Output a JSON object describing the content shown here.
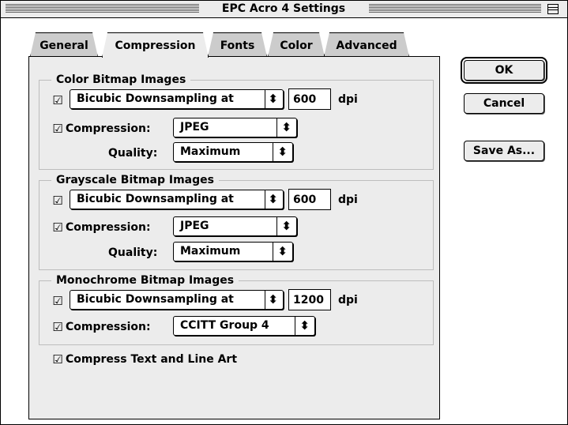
{
  "window": {
    "title": "EPC Acro 4 Settings"
  },
  "tabs": [
    {
      "label": "General",
      "active": false
    },
    {
      "label": "Compression",
      "active": true
    },
    {
      "label": "Fonts",
      "active": false
    },
    {
      "label": "Color",
      "active": false
    },
    {
      "label": "Advanced",
      "active": false
    }
  ],
  "color": {
    "title": "Color Bitmap Images",
    "downsample_checked": true,
    "downsample": "Bicubic Downsampling at",
    "dpi_value": "600",
    "compression_checked": true,
    "compression_label": "Compression:",
    "compression": "JPEG",
    "quality_label": "Quality:",
    "quality": "Maximum"
  },
  "grayscale": {
    "title": "Grayscale Bitmap Images",
    "downsample_checked": true,
    "downsample": "Bicubic Downsampling at",
    "dpi_value": "600",
    "compression_checked": true,
    "compression_label": "Compression:",
    "compression": "JPEG",
    "quality_label": "Quality:",
    "quality": "Maximum"
  },
  "mono": {
    "title": "Monochrome Bitmap Images",
    "downsample_checked": true,
    "downsample": "Bicubic Downsampling at",
    "dpi_value": "1200",
    "compression_checked": true,
    "compression_label": "Compression:",
    "compression": "CCITT Group 4"
  },
  "dpi_unit": "dpi",
  "compress_text": {
    "label": "Compress Text and Line Art",
    "checked": true
  },
  "checkbox_glyph": "☑",
  "popup_arrows": "⬍",
  "popup_arrows_single": "▲▼",
  "buttons": {
    "ok": "OK",
    "cancel": "Cancel",
    "save_as": "Save As..."
  }
}
